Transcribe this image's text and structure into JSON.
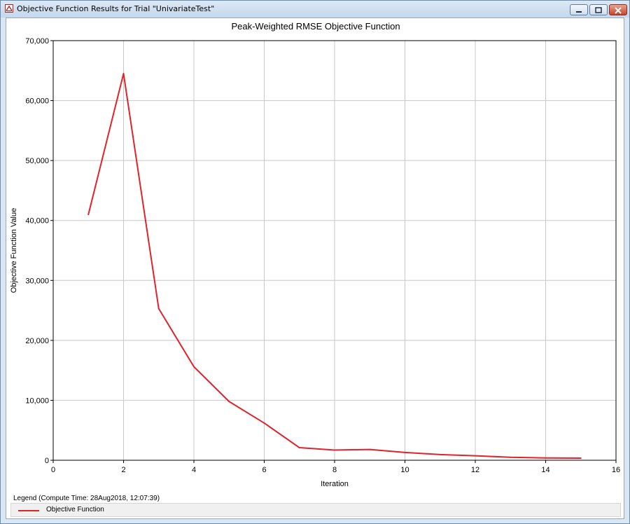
{
  "window": {
    "title": "Objective Function Results for Trial \"UnivariateTest\"",
    "icon": "app-icon",
    "buttons": [
      "minimize-icon",
      "maximize-icon",
      "close-icon"
    ]
  },
  "legend": {
    "header": "Legend (Compute Time: 28Aug2018, 12:07:39)",
    "items": [
      {
        "label": "Objective Function",
        "color": "#e0232b"
      }
    ]
  },
  "chart_data": {
    "type": "line",
    "title": "Peak-Weighted RMSE Objective Function",
    "xlabel": "Iteration",
    "ylabel": "Objective Function Value",
    "xlim": [
      0,
      16
    ],
    "ylim": [
      0,
      70000
    ],
    "xticks": [
      0,
      2,
      4,
      6,
      8,
      10,
      12,
      14,
      16
    ],
    "yticks": [
      0,
      10000,
      20000,
      30000,
      40000,
      50000,
      60000,
      70000
    ],
    "ytick_labels": [
      "0",
      "10,000",
      "20,000",
      "30,000",
      "40,000",
      "50,000",
      "60,000",
      "70,000"
    ],
    "grid": true,
    "legend_position": "bottom",
    "series": [
      {
        "name": "Objective Function",
        "color": "#e0232b",
        "x": [
          1,
          2,
          3,
          4,
          5,
          6,
          7,
          8,
          9,
          10,
          11,
          12,
          13,
          14,
          15
        ],
        "y": [
          41000,
          64500,
          25300,
          15600,
          9800,
          6200,
          2100,
          1700,
          1800,
          1300,
          950,
          750,
          500,
          380,
          350
        ]
      }
    ]
  }
}
